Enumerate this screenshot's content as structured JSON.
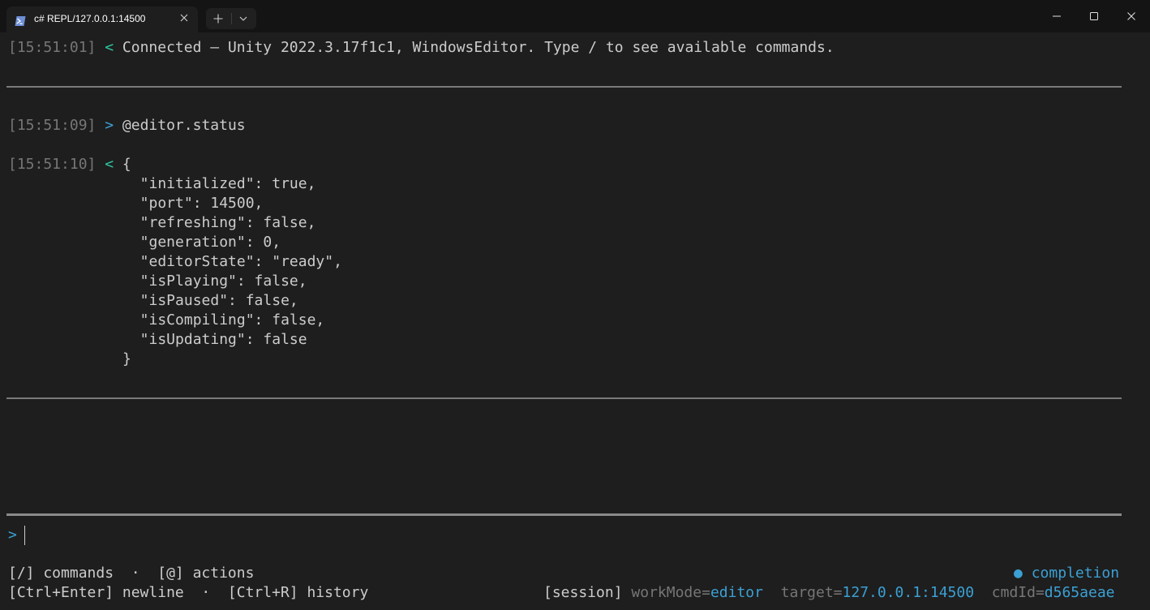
{
  "window": {
    "tab_title": "c# REPL/127.0.0.1:14500",
    "tab_icon": "powershell-icon",
    "new_tab_icon": "plus-icon",
    "dropdown_icon": "chevron-down-icon",
    "controls": [
      "minimize-icon",
      "maximize-icon",
      "close-icon"
    ]
  },
  "colors": {
    "background": "#1e1e1e",
    "timestamp": "#767676",
    "input_arrow": "#3ba0d4",
    "output_arrow": "#2fc6a0",
    "accent": "#3ba0d4"
  },
  "log": {
    "entry1": {
      "timestamp": "[15:51:01]",
      "direction": "<",
      "text": "Connected — Unity 2022.3.17f1c1, WindowsEditor. Type / to see available commands."
    },
    "entry2": {
      "timestamp": "[15:51:09]",
      "direction": ">",
      "text": "@editor.status"
    },
    "entry3": {
      "timestamp": "[15:51:10]",
      "direction": "<",
      "open": "{",
      "lines": [
        "  \"initialized\": true,",
        "  \"port\": 14500,",
        "  \"refreshing\": false,",
        "  \"generation\": 0,",
        "  \"editorState\": \"ready\",",
        "  \"isPlaying\": false,",
        "  \"isPaused\": false,",
        "  \"isCompiling\": false,",
        "  \"isUpdating\": false"
      ],
      "close": "}"
    }
  },
  "input": {
    "prompt": ">",
    "value": ""
  },
  "footer": {
    "hint1": "[/] commands  ·  [@] actions",
    "hint2": "[Ctrl+Enter] newline  ·  [Ctrl+R] history",
    "completion_dot": "●",
    "completion_label": "completion",
    "session_label": "[session]",
    "workmode_key": "workMode=",
    "workmode_value": "editor",
    "target_key": "target=",
    "target_value": "127.0.0.1:14500",
    "cmdid_key": "cmdId=",
    "cmdid_value": "d565aeae"
  }
}
